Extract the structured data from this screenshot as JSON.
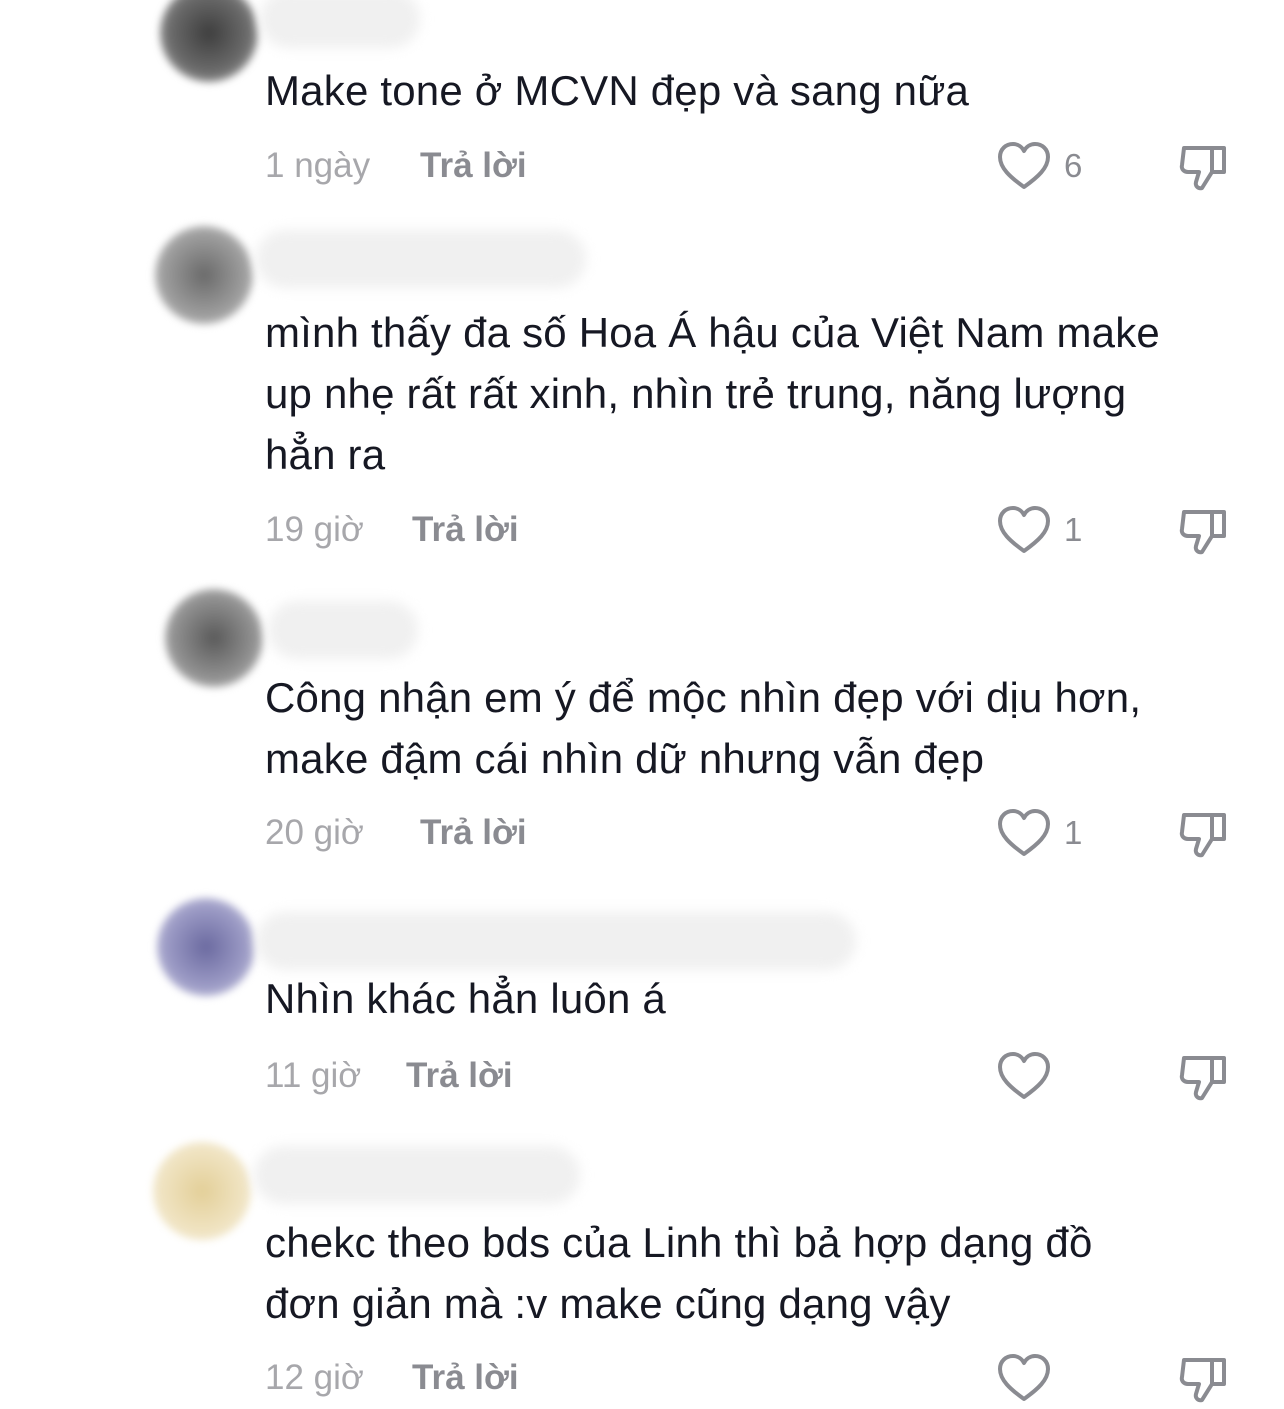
{
  "comments": [
    {
      "text": "Make tone ở MCVN đẹp và sang nữa",
      "time": "1 ngày",
      "reply": "Trả lời",
      "likes": "6",
      "avatar_color": "#4a4a4a"
    },
    {
      "text": "mình thấy đa số Hoa Á hậu của Việt Nam make\nup nhẹ rất rất xinh, nhìn trẻ trung, năng lượng\nhẳn ra",
      "time": "19 giờ",
      "reply": "Trả lời",
      "likes": "1",
      "avatar_color": "#7a7a7a"
    },
    {
      "text": "Công nhận em ý để mộc nhìn đẹp với dịu hơn,\nmake đậm cái nhìn dữ nhưng vẫn đẹp",
      "time": "20 giờ",
      "reply": "Trả lời",
      "likes": "1",
      "avatar_color": "#6e6e6e"
    },
    {
      "text": "Nhìn khác hẳn luôn á",
      "time": "11 giờ",
      "reply": "Trả lời",
      "likes": "",
      "avatar_color": "#6f6d9e"
    },
    {
      "text": "chekc theo bds của Linh thì bả hợp dạng đồ\nđơn giản mà :v make cũng dạng vậy",
      "time": "12 giờ",
      "reply": "Trả lời",
      "likes": "",
      "avatar_color": "#e8d6a6"
    }
  ],
  "icons": {
    "like": "heart-outline-icon",
    "dislike": "thumbs-down-outline-icon"
  },
  "colors": {
    "text": "#161823",
    "meta": "#a7a7ab",
    "reply": "#8a8b91",
    "icon": "#8a8b91"
  }
}
